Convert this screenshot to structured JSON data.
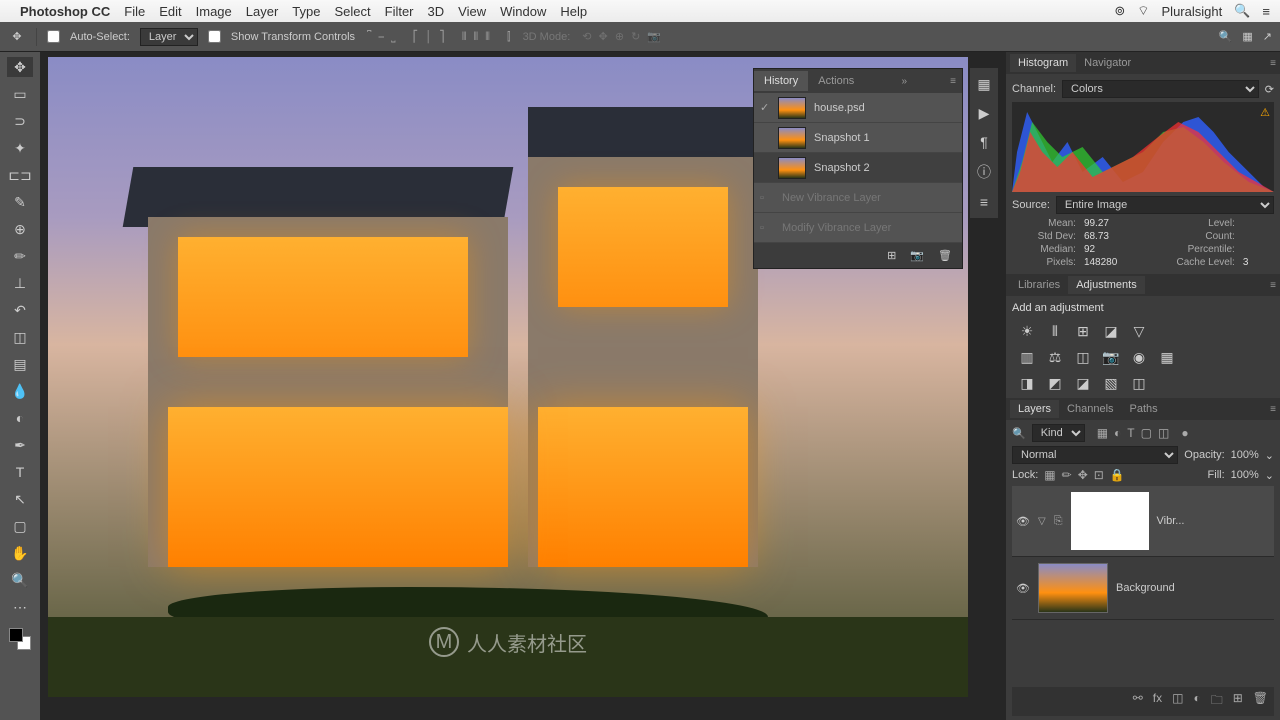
{
  "menubar": {
    "app": "Photoshop CC",
    "items": [
      "File",
      "Edit",
      "Image",
      "Layer",
      "Type",
      "Select",
      "Filter",
      "3D",
      "View",
      "Window",
      "Help"
    ],
    "account": "Pluralsight"
  },
  "options": {
    "auto_select": "Auto-Select:",
    "layer_dropdown": "Layer",
    "show_transform": "Show Transform Controls",
    "mode3d": "3D Mode:"
  },
  "history": {
    "tabs": [
      "History",
      "Actions"
    ],
    "items": [
      {
        "label": "house.psd",
        "snapshot": true,
        "brush": true
      },
      {
        "label": "Snapshot 1",
        "snapshot": true
      },
      {
        "label": "Snapshot 2",
        "snapshot": true,
        "selected": true
      },
      {
        "label": "New Vibrance Layer",
        "inactive": true
      },
      {
        "label": "Modify Vibrance Layer",
        "inactive": true
      }
    ]
  },
  "histogram": {
    "tabs": [
      "Histogram",
      "Navigator"
    ],
    "channel_label": "Channel:",
    "channel": "Colors",
    "source_label": "Source:",
    "source": "Entire Image",
    "stats": {
      "mean_l": "Mean:",
      "mean_v": "99.27",
      "std_l": "Std Dev:",
      "std_v": "68.73",
      "median_l": "Median:",
      "median_v": "92",
      "pixels_l": "Pixels:",
      "pixels_v": "148280",
      "level_l": "Level:",
      "level_v": "",
      "count_l": "Count:",
      "count_v": "",
      "perc_l": "Percentile:",
      "perc_v": "",
      "cache_l": "Cache Level:",
      "cache_v": "3"
    }
  },
  "adjustments": {
    "tabs": [
      "Libraries",
      "Adjustments"
    ],
    "title": "Add an adjustment"
  },
  "layers": {
    "tabs": [
      "Layers",
      "Channels",
      "Paths"
    ],
    "filter_label": "Kind",
    "blend_mode": "Normal",
    "opacity_label": "Opacity:",
    "opacity": "100%",
    "lock_label": "Lock:",
    "fill_label": "Fill:",
    "fill": "100%",
    "items": [
      {
        "name": "Vibr...",
        "adj": true,
        "selected": true
      },
      {
        "name": "Background",
        "adj": false
      }
    ]
  },
  "watermark": "人人素材社区"
}
